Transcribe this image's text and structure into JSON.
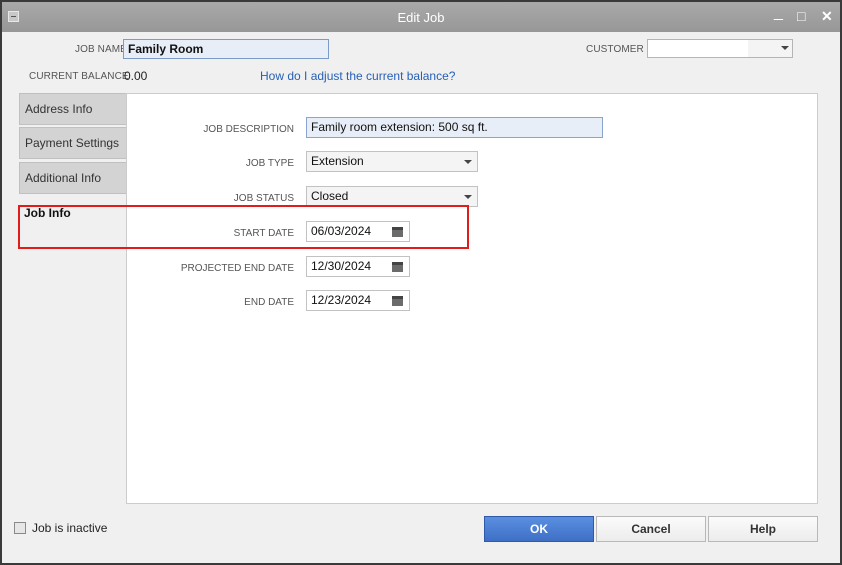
{
  "window": {
    "title": "Edit Job",
    "controls": {
      "minimize": "_",
      "maximize": "□",
      "close": "✕"
    }
  },
  "header": {
    "job_name_label": "JOB NAME",
    "job_name_value": "Family Room",
    "customer_label": "CUSTOMER",
    "customer_value": "",
    "balance_label": "CURRENT BALANCE",
    "balance_value": "0.00",
    "adjust_link": "How do I adjust the current balance?"
  },
  "tabs": [
    {
      "label": "Address Info",
      "active": false
    },
    {
      "label": "Payment Settings",
      "active": false
    },
    {
      "label": "Additional Info",
      "active": false
    },
    {
      "label": "Job Info",
      "active": true
    }
  ],
  "job_info": {
    "description_label": "JOB DESCRIPTION",
    "description_value": "Family room extension: 500 sq ft.",
    "type_label": "JOB TYPE",
    "type_value": "Extension",
    "status_label": "JOB STATUS",
    "status_value": "Closed",
    "start_label": "START DATE",
    "start_value": "06/03/2024",
    "projected_end_label": "PROJECTED END DATE",
    "projected_end_value": "12/30/2024",
    "end_label": "END DATE",
    "end_value": "12/23/2024"
  },
  "footer": {
    "inactive_label": "Job is inactive",
    "inactive_checked": false,
    "ok_label": "OK",
    "cancel_label": "Cancel",
    "help_label": "Help"
  },
  "colors": {
    "titlebar": "#a2a2a2",
    "primary_button": "#4a7dd4",
    "link": "#2760b6",
    "highlight": "#e21b1b"
  },
  "icons": {
    "system_menu": "system-menu-icon",
    "dropdown": "caret-down-icon",
    "calendar": "calendar-icon"
  }
}
